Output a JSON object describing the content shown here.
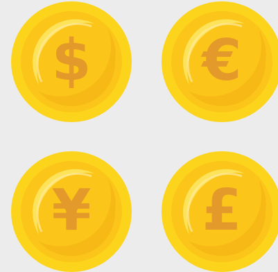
{
  "coins": [
    {
      "name": "dollar",
      "symbol": "$"
    },
    {
      "name": "euro",
      "symbol": "€"
    },
    {
      "name": "yen",
      "symbol": "¥"
    },
    {
      "name": "pound",
      "symbol": "£"
    }
  ],
  "colors": {
    "background": "#ececec",
    "rim": "#fcd41c",
    "face": "#fbc51a",
    "shadow": "#f4ae12",
    "highlight": "#fde560",
    "symbol": "#e39a2a"
  },
  "icons": [
    "dollar-coin-icon",
    "euro-coin-icon",
    "yen-coin-icon",
    "pound-coin-icon"
  ]
}
